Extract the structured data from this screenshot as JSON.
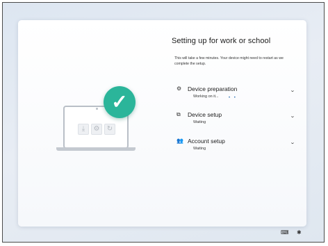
{
  "oobe": {
    "title": "Setting up for work or school",
    "description": "This will take a few minutes. Your device might need to restart as we complete the setup.",
    "steps": [
      {
        "name": "Device preparation",
        "status": "Working on it...",
        "icon": "gear-icon",
        "progress_dots": "• •"
      },
      {
        "name": "Device setup",
        "status": "Waiting",
        "icon": "devices-icon"
      },
      {
        "name": "Account setup",
        "status": "Waiting",
        "icon": "people-icon"
      }
    ]
  },
  "illustration": {
    "laptop_icons": [
      "download-icon",
      "gear-icon",
      "refresh-icon"
    ],
    "check_glyph": "✓",
    "check_color": "#2bb59a"
  },
  "taskbar": {
    "icons": [
      "keyboard-icon",
      "accessibility-icon"
    ]
  }
}
